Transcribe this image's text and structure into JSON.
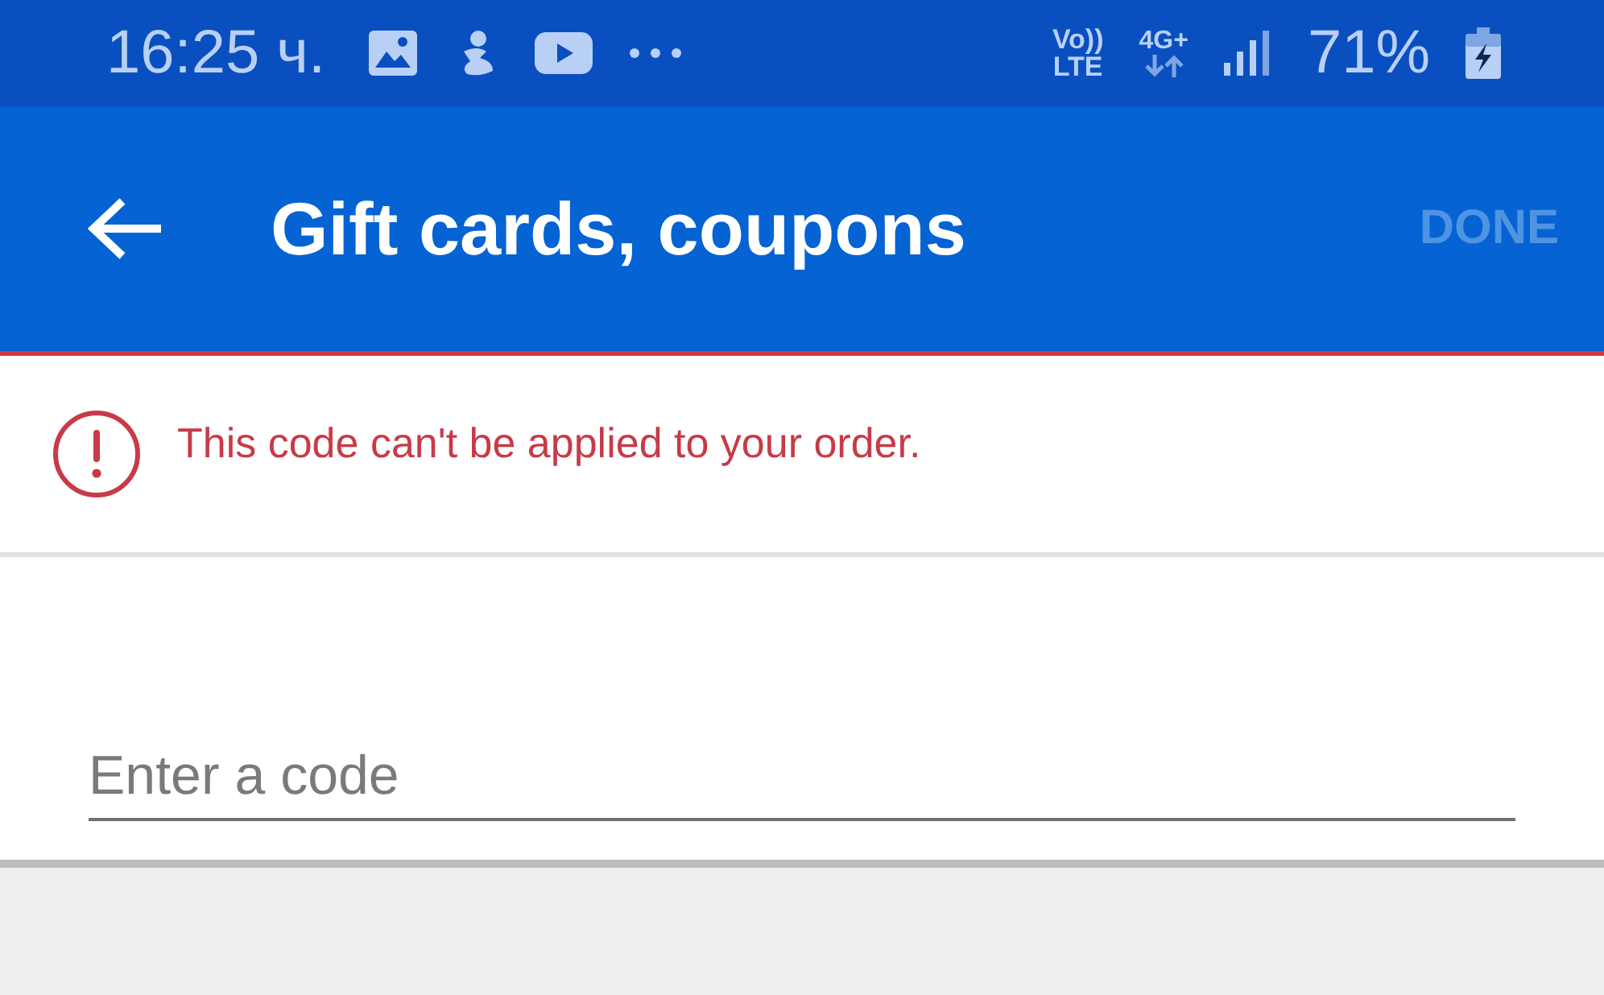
{
  "status_bar": {
    "time": "16:25 ч.",
    "volte_top": "Vo))",
    "volte_bottom": "LTE",
    "network": "4G+",
    "battery": "71%"
  },
  "app_bar": {
    "title": "Gift cards, coupons",
    "done_button": {
      "label": "DONE",
      "disabled": true
    }
  },
  "error": {
    "message": "This code can't be applied to your order."
  },
  "code_field": {
    "placeholder": "Enter a code"
  }
}
